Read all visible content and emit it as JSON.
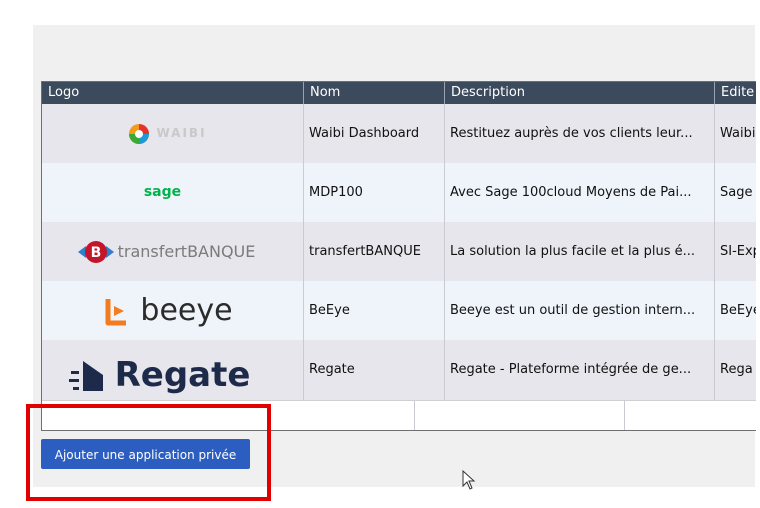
{
  "table": {
    "columns": [
      "Logo",
      "Nom",
      "Description",
      "Edite"
    ],
    "rows": [
      {
        "logo": "waibi-logo",
        "logo_text": "WAIBI",
        "nom": "Waibi Dashboard",
        "description": "Restituez auprès de vos clients leur...",
        "editeur": "Waibi"
      },
      {
        "logo": "sage-logo",
        "logo_text": "sage",
        "nom": "MDP100",
        "description": "Avec Sage 100cloud Moyens de Pai...",
        "editeur": "Sage"
      },
      {
        "logo": "transfertbanque-logo",
        "logo_text": "transfertBANQUE",
        "nom": "transfertBANQUE",
        "description": "La solution la plus facile et la plus é...",
        "editeur": "SI-Exp"
      },
      {
        "logo": "beeye-logo",
        "logo_text": "beeye",
        "nom": "BeEye",
        "description": "Beeye est un outil de gestion intern...",
        "editeur": "BeEye"
      },
      {
        "logo": "regate-logo",
        "logo_text": "Regate",
        "nom": "Regate",
        "description": "Regate - Plateforme intégrée de ge...",
        "editeur": "Rega"
      }
    ]
  },
  "actions": {
    "add_private_app_label": "Ajouter une application privée"
  },
  "colors": {
    "header_bg": "#3c4a5e",
    "button_bg": "#2b5ec0",
    "highlight_border": "#e10000"
  }
}
